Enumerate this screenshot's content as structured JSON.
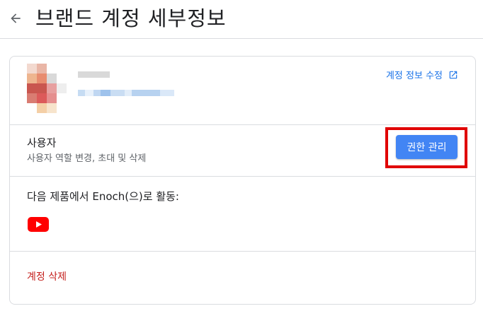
{
  "header": {
    "back_icon": "arrow-left-icon",
    "title": "브랜드 계정 세부정보"
  },
  "profile": {
    "avatar_colors": [
      "#f3d9cf",
      "#e9b6a6",
      "#ffffff",
      "#ffffff",
      "#eeb58f",
      "#e88c6f",
      "#d9d9d9",
      "#ffffff",
      "#c9564f",
      "#c9564f",
      "#e7a0a0",
      "#eeeeee",
      "#d97c72",
      "#dc5a5a",
      "#e58f8f",
      "#ffffff",
      "#ffffff",
      "#f4cfa6",
      "#f7e4cc",
      "#ffffff"
    ],
    "email_blur_colors": [
      "#c6dcf3",
      "#e8f1fb",
      "#c0d7f2",
      "#9ec2ec",
      "#c9ddf3",
      "#e2edf9",
      "#b7d2f0",
      "#dae8f8"
    ],
    "edit_label": "계정 정보 수정",
    "edit_icon": "open-in-new-icon",
    "link_color": "#1a73e8"
  },
  "users": {
    "title": "사용자",
    "subtitle": "사용자 역할 변경, 초대 및 삭제",
    "manage_button": "권한 관리",
    "button_color": "#4285f4",
    "highlight_color": "#e00000"
  },
  "products": {
    "label": "다음 제품에서 Enoch(으)로 활동:",
    "icon": "youtube-icon"
  },
  "danger": {
    "delete_label": "계정 삭제",
    "color": "#c5221f"
  }
}
